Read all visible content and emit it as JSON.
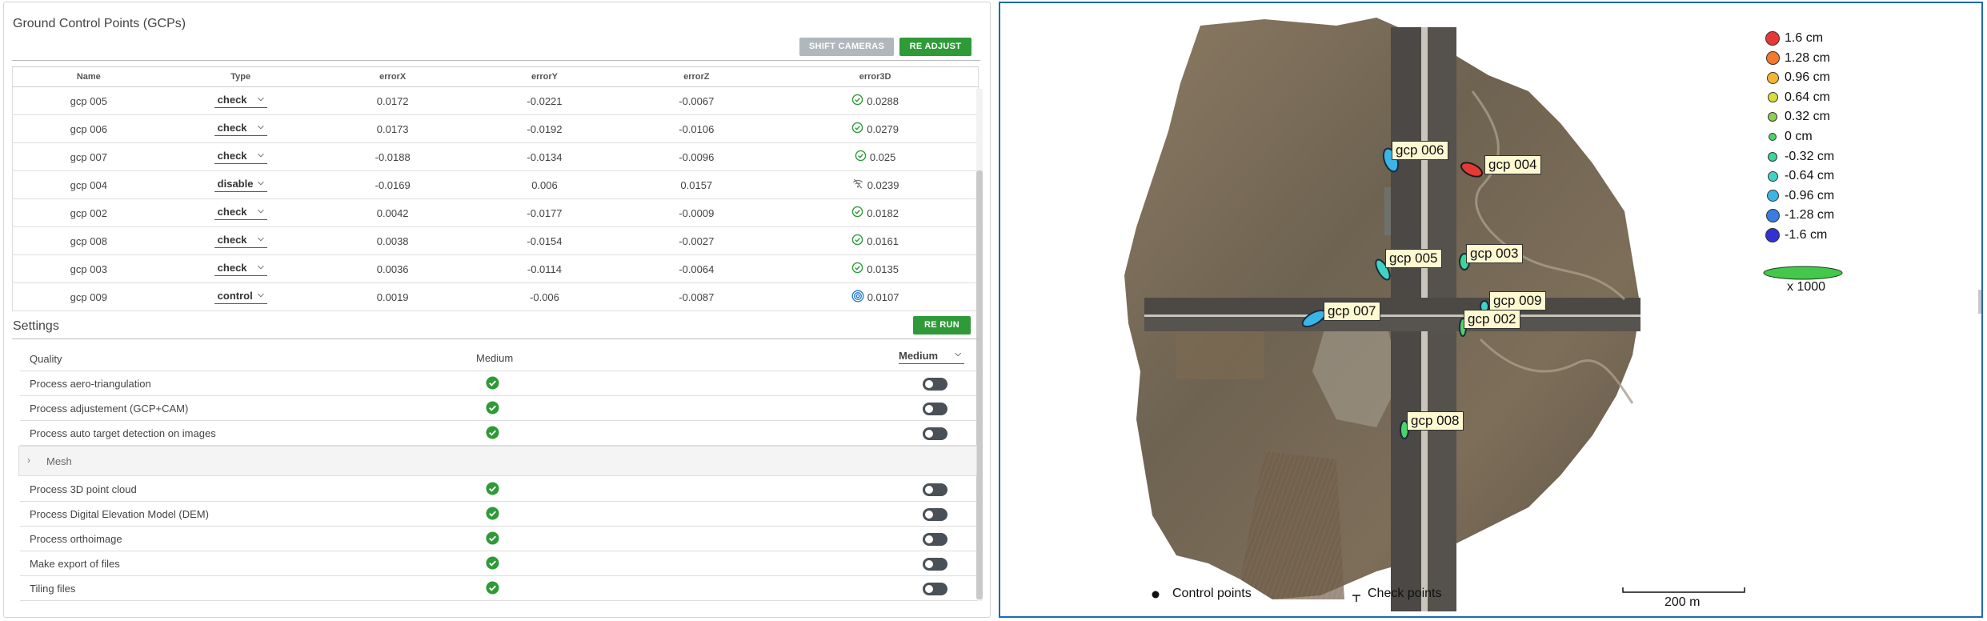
{
  "gcp_panel": {
    "title": "Ground Control Points (GCPs)",
    "shift_cameras_label": "SHIFT CAMERAS",
    "re_adjust_label": "RE ADJUST",
    "columns": [
      "Name",
      "Type",
      "errorX",
      "errorY",
      "errorZ",
      "error3D"
    ],
    "rows": [
      {
        "name": "gcp 005",
        "type": "check",
        "errorX": "0.0172",
        "errorY": "-0.0221",
        "errorZ": "-0.0067",
        "error3D": "0.0288",
        "status_icon": "check-circle-icon"
      },
      {
        "name": "gcp 006",
        "type": "check",
        "errorX": "0.0173",
        "errorY": "-0.0192",
        "errorZ": "-0.0106",
        "error3D": "0.0279",
        "status_icon": "check-circle-icon"
      },
      {
        "name": "gcp 007",
        "type": "check",
        "errorX": "-0.0188",
        "errorY": "-0.0134",
        "errorZ": "-0.0096",
        "error3D": "0.025",
        "status_icon": "check-circle-icon"
      },
      {
        "name": "gcp 004",
        "type": "disable",
        "errorX": "-0.0169",
        "errorY": "0.006",
        "errorZ": "0.0157",
        "error3D": "0.0239",
        "status_icon": "wifi-off-icon"
      },
      {
        "name": "gcp 002",
        "type": "check",
        "errorX": "0.0042",
        "errorY": "-0.0177",
        "errorZ": "-0.0009",
        "error3D": "0.0182",
        "status_icon": "check-circle-icon"
      },
      {
        "name": "gcp 008",
        "type": "check",
        "errorX": "0.0038",
        "errorY": "-0.0154",
        "errorZ": "-0.0027",
        "error3D": "0.0161",
        "status_icon": "check-circle-icon"
      },
      {
        "name": "gcp 003",
        "type": "check",
        "errorX": "0.0036",
        "errorY": "-0.0114",
        "errorZ": "-0.0064",
        "error3D": "0.0135",
        "status_icon": "check-circle-icon"
      },
      {
        "name": "gcp 009",
        "type": "control",
        "errorX": "0.0019",
        "errorY": "-0.006",
        "errorZ": "-0.0087",
        "error3D": "0.0107",
        "status_icon": "target-icon"
      }
    ]
  },
  "settings": {
    "title": "Settings",
    "re_run_label": "RE RUN",
    "quality_label": "Quality",
    "quality_value": "Medium",
    "quality_select": "Medium",
    "mesh_label": "Mesh",
    "rows_top": [
      {
        "label": "Process aero-triangulation",
        "enabled": true,
        "toggle_on": false
      },
      {
        "label": "Process adjustement (GCP+CAM)",
        "enabled": true,
        "toggle_on": false
      },
      {
        "label": "Process auto target detection on images",
        "enabled": true,
        "toggle_on": false
      }
    ],
    "rows_bottom": [
      {
        "label": "Process 3D point cloud",
        "enabled": true,
        "toggle_on": false
      },
      {
        "label": "Process Digital Elevation Model (DEM)",
        "enabled": true,
        "toggle_on": false
      },
      {
        "label": "Process orthoimage",
        "enabled": true,
        "toggle_on": false
      },
      {
        "label": "Make export of files",
        "enabled": true,
        "toggle_on": false
      },
      {
        "label": "Tiling files",
        "enabled": true,
        "toggle_on": false
      }
    ]
  },
  "map": {
    "gcp_labels": [
      "gcp 006",
      "gcp 004",
      "gcp 005",
      "gcp 003",
      "gcp 009",
      "gcp 002",
      "gcp 007",
      "gcp 008"
    ],
    "legend": [
      {
        "label": "1.6 cm",
        "color": "#e53935"
      },
      {
        "label": "1.28 cm",
        "color": "#f4792b"
      },
      {
        "label": "0.96 cm",
        "color": "#f5b431"
      },
      {
        "label": "0.64 cm",
        "color": "#d7dd3a"
      },
      {
        "label": "0.32 cm",
        "color": "#8fd14f"
      },
      {
        "label": "0 cm",
        "color": "#4cd36a"
      },
      {
        "label": "-0.32 cm",
        "color": "#3cd59a"
      },
      {
        "label": "-0.64 cm",
        "color": "#3fd3c6"
      },
      {
        "label": "-0.96 cm",
        "color": "#3ab5e6"
      },
      {
        "label": "-1.28 cm",
        "color": "#3a7ce0"
      },
      {
        "label": "-1.6 cm",
        "color": "#3131d4"
      }
    ],
    "scale_factor_label": "x 1000",
    "control_points_label": "Control points",
    "check_points_label": "Check points",
    "scale_bar_label": "200 m"
  }
}
